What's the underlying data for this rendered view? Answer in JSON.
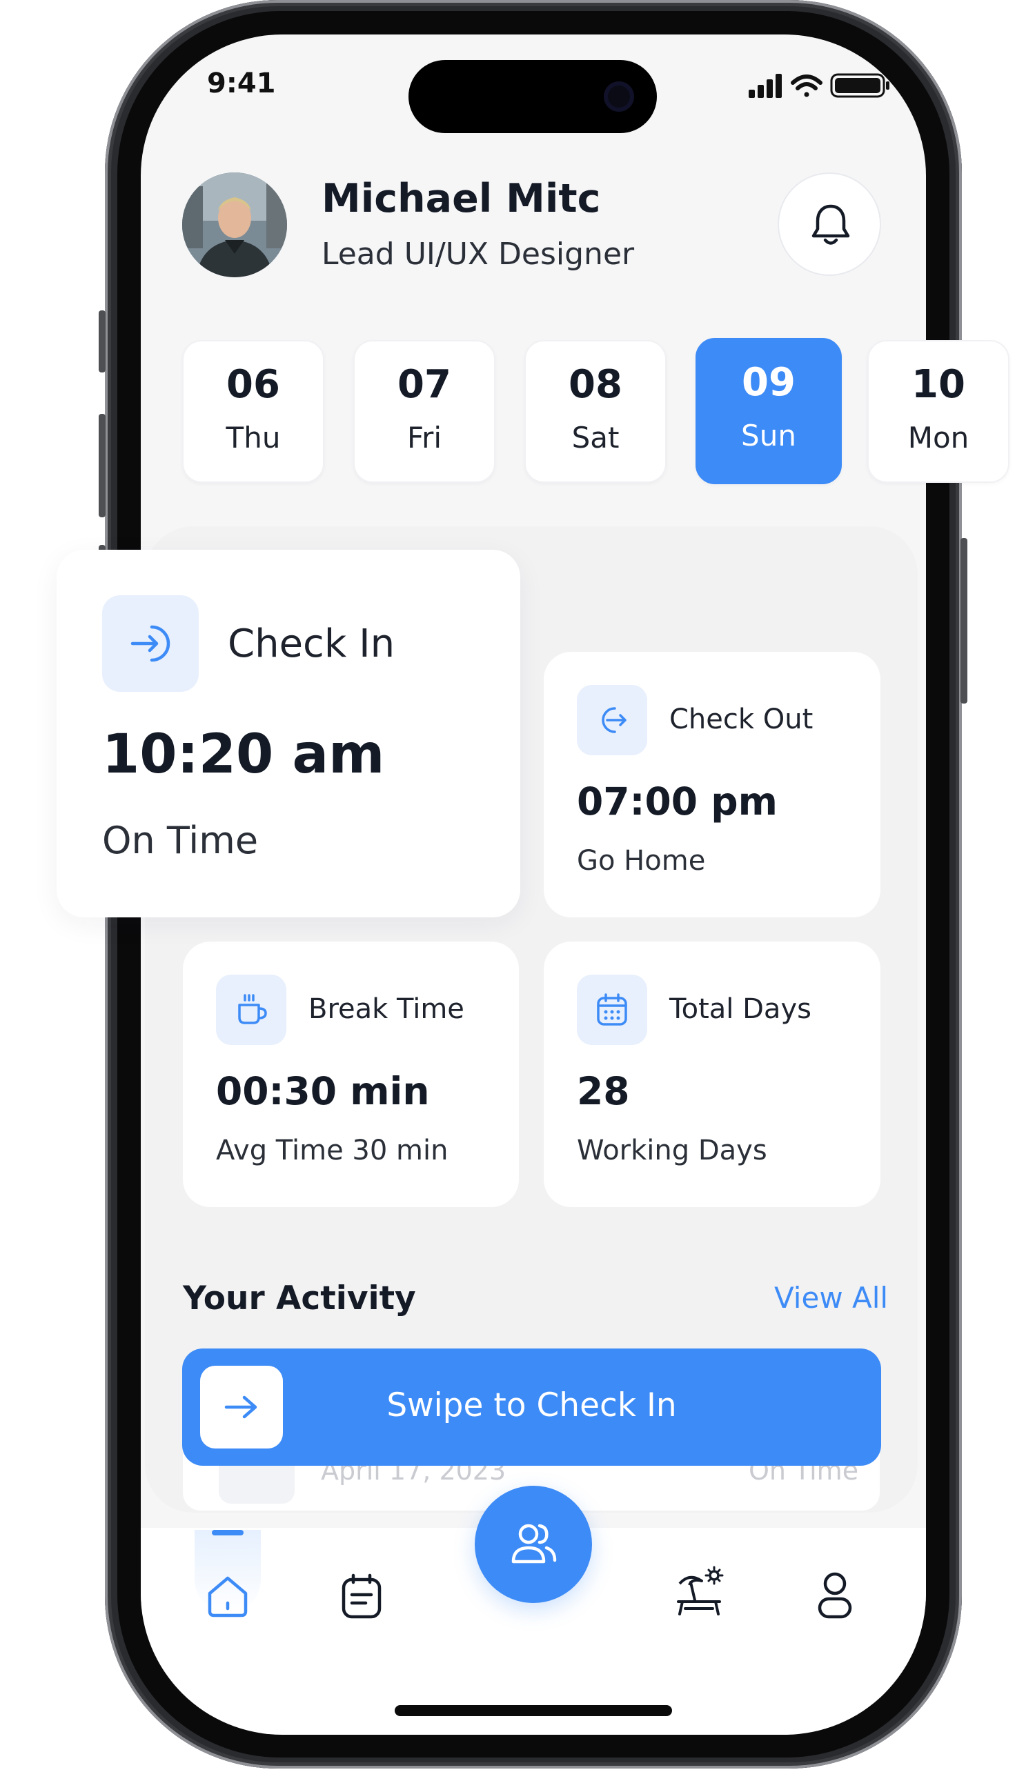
{
  "status_bar": {
    "time": "9:41"
  },
  "header": {
    "name": "Michael Mitc",
    "role": "Lead UI/UX Designer",
    "notification_icon": "bell-icon"
  },
  "dates": [
    {
      "num": "06",
      "day": "Thu",
      "active": false
    },
    {
      "num": "07",
      "day": "Fri",
      "active": false
    },
    {
      "num": "08",
      "day": "Sat",
      "active": false
    },
    {
      "num": "09",
      "day": "Sun",
      "active": true
    },
    {
      "num": "10",
      "day": "Mon",
      "active": false
    }
  ],
  "stats": {
    "check_in": {
      "title": "Check In",
      "value": "10:20 am",
      "sub": "On Time",
      "icon": "login-arrow-icon"
    },
    "check_out": {
      "title": "Check Out",
      "value": "07:00 pm",
      "sub": "Go Home",
      "icon": "logout-arrow-icon"
    },
    "break_time": {
      "title": "Break Time",
      "value": "00:30 min",
      "sub": "Avg Time 30 min",
      "icon": "coffee-cup-icon"
    },
    "total_days": {
      "title": "Total Days",
      "value": "28",
      "sub": "Working Days",
      "icon": "calendar-icon"
    }
  },
  "activity": {
    "title": "Your Activity",
    "view_all": "View All",
    "ghost_row": {
      "date": "April 17, 2023",
      "status": "On Time"
    }
  },
  "swipe": {
    "label": "Swipe to Check In"
  },
  "nav": {
    "items": [
      "home-icon",
      "notes-icon",
      "team-icon",
      "vacation-icon",
      "profile-icon"
    ],
    "active": "home-icon"
  },
  "colors": {
    "accent": "#3d8bf6",
    "accent_light": "#e8f0fd",
    "text": "#141a26"
  }
}
